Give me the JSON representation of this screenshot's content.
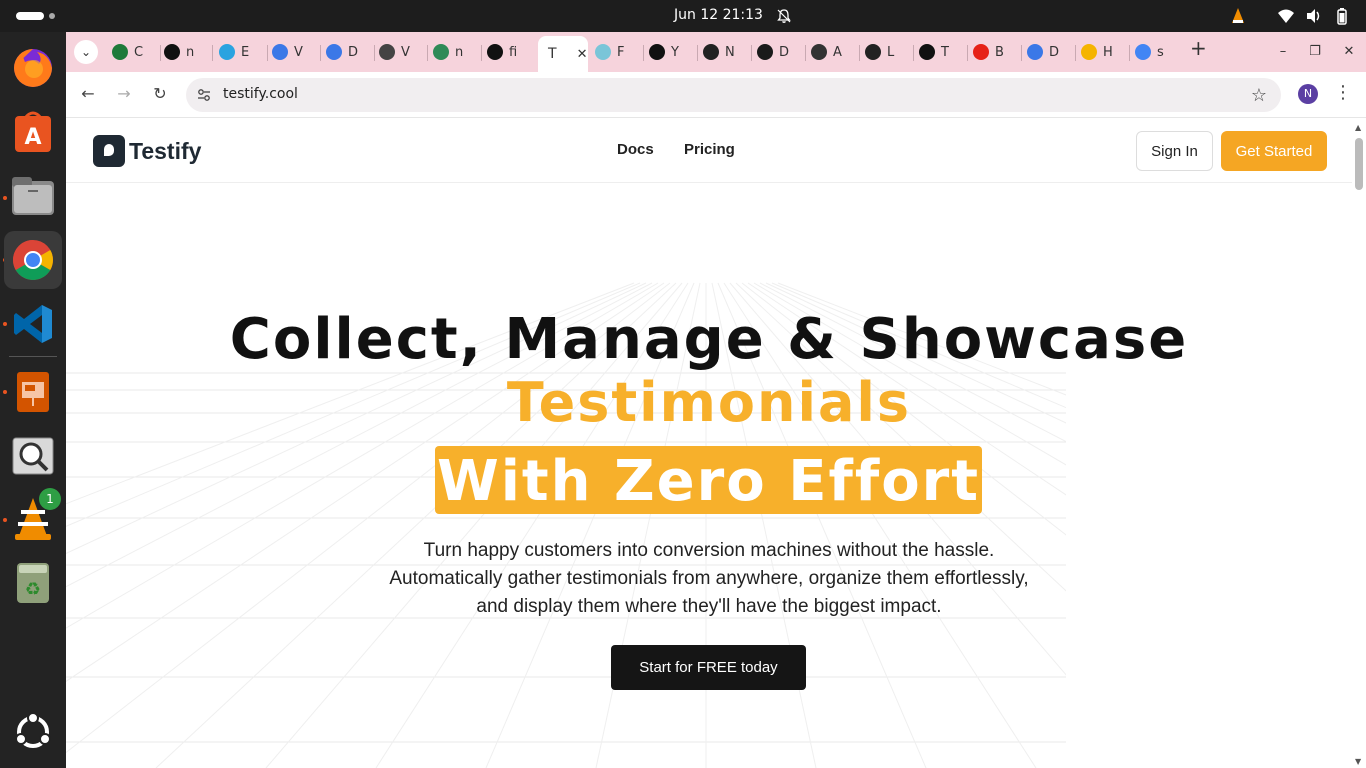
{
  "system": {
    "clock": "Jun 12  21:13"
  },
  "dock": {
    "items": [
      "firefox-icon",
      "app-center-icon",
      "files-icon",
      "chrome-icon",
      "vscode-icon",
      "impress-icon",
      "image-viewer-icon",
      "vlc-icon",
      "trash-icon",
      "show-apps-icon"
    ],
    "vlc_badge": "1"
  },
  "browser": {
    "tabs": [
      {
        "letter": "C",
        "color": "#1f7a3a",
        "icon": "mongodb-icon"
      },
      {
        "letter": "n",
        "color": "#111111",
        "icon": "nextjs-icon"
      },
      {
        "letter": "E",
        "color": "#2aa3e0",
        "icon": "telegram-icon"
      },
      {
        "letter": "V",
        "color": "#3b78e7",
        "icon": "docs-icon"
      },
      {
        "letter": "D",
        "color": "#3b78e7",
        "icon": "docs-icon"
      },
      {
        "letter": "V",
        "color": "#444444",
        "icon": "search-circle-icon"
      },
      {
        "letter": "n",
        "color": "#2f8a57",
        "icon": "gear-circle-icon"
      },
      {
        "letter": "fi",
        "color": "#111111",
        "icon": "x-icon"
      },
      {
        "letter": "F",
        "color": "#7ac5d8",
        "icon": "play-circle-icon"
      },
      {
        "letter": "Y",
        "color": "#111111",
        "icon": "github-icon"
      },
      {
        "letter": "N",
        "color": "#222222",
        "icon": "openai-icon"
      },
      {
        "letter": "D",
        "color": "#1a1a1a",
        "icon": "supabase-icon"
      },
      {
        "letter": "A",
        "color": "#333333",
        "icon": "openai-icon"
      },
      {
        "letter": "L",
        "color": "#222222",
        "icon": "bolt-icon"
      },
      {
        "letter": "T",
        "color": "#111111",
        "icon": "bolt-square-icon"
      },
      {
        "letter": "B",
        "color": "#e62117",
        "icon": "youtube-icon"
      },
      {
        "letter": "D",
        "color": "#3b78e7",
        "icon": "dashboard-icon"
      },
      {
        "letter": "H",
        "color": "#f5b400",
        "icon": "arrow-icon"
      },
      {
        "letter": "s",
        "color": "#4285f4",
        "icon": "google-icon"
      }
    ],
    "active_tab_label": "T",
    "url": "testify.cool",
    "profile_initial": "N"
  },
  "site": {
    "logo_text": "Testify",
    "nav": {
      "docs": "Docs",
      "pricing": "Pricing",
      "sign_in": "Sign In",
      "get_started": "Get Started"
    },
    "hero": {
      "line1": "Collect, Manage & Showcase",
      "line2": "Testimonials",
      "line3": "With Zero Effort",
      "sub1": "Turn happy customers into conversion machines without the hassle.",
      "sub2": "Automatically gather testimonials from anywhere, organize them effortlessly,",
      "sub3": "and display them where they'll have the biggest impact.",
      "cta": "Start for FREE today"
    },
    "accent_color": "#f7b02b"
  }
}
